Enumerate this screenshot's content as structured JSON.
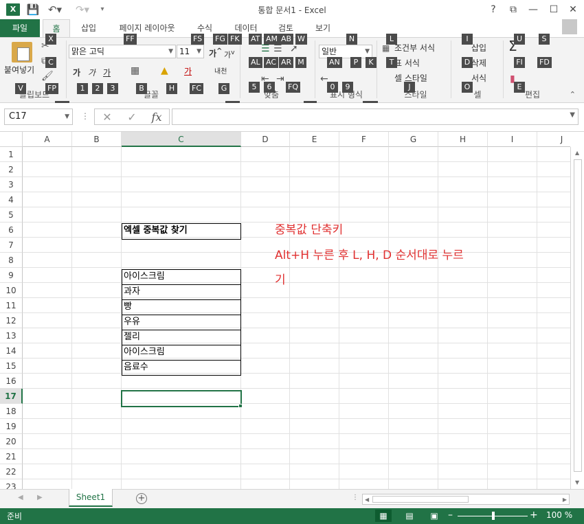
{
  "window": {
    "title": "통합 문서1 - Excel",
    "help": "?",
    "minimize": "—",
    "restore": "☐",
    "close": "✕",
    "ribbon_display": "⧉"
  },
  "tabs": [
    {
      "label": "파일"
    },
    {
      "label": "홈"
    },
    {
      "label": "삽입"
    },
    {
      "label": "페이지 레이아웃"
    },
    {
      "label": "수식"
    },
    {
      "label": "데이터"
    },
    {
      "label": "검토"
    },
    {
      "label": "보기"
    }
  ],
  "ribbon": {
    "paste_label": "붙여넣기",
    "font_name": "맑은 고딕",
    "font_size": "11",
    "bold": "가",
    "italic": "가",
    "underline": "가",
    "number_format": "일반",
    "conditional_format": "조건부 서식",
    "table_format": "표 서식",
    "cell_style": "셀 스타일",
    "insert": "삽입",
    "delete": "삭제",
    "format": "서식",
    "sum": "Σ",
    "groups": {
      "clipboard": "클립보드",
      "font": "글꼴",
      "alignment": "맞춤",
      "number": "표시 형식",
      "styles": "스타일",
      "cells": "셀",
      "editing": "편집"
    },
    "keytips": {
      "paste": "V",
      "cut": "X",
      "copy": "C",
      "format_painter": "FP",
      "clipboard_launcher": "FO",
      "font_name": "FF",
      "font_size": "FS",
      "grow": "FG",
      "shrink": "FK",
      "bold": "1",
      "italic": "2",
      "underline": "3",
      "borders": "B",
      "fill": "H",
      "font_color": "FC",
      "phonetic": "G",
      "font_launcher": "FN",
      "align_top": "AT",
      "align_middle": "AM",
      "align_bottom": "AB",
      "orientation": "FQ",
      "wrap": "W",
      "align_left": "AL",
      "align_center": "AC",
      "align_right": "AR",
      "merge": "M",
      "indent_dec": "5",
      "indent_inc": "6",
      "number_format": "N",
      "accounting": "AN",
      "percent": "P",
      "comma": "K",
      "dec_inc": "0",
      "dec_dec": "9",
      "number_launcher": "FM",
      "align_launcher": "FA",
      "conditional": "L",
      "table": "T",
      "cell_style": "J",
      "insert": "I",
      "delete": "D",
      "format": "O",
      "sum": "U",
      "fill_down": "FI",
      "clear": "E",
      "sort": "S",
      "find": "FD"
    }
  },
  "formula_bar": {
    "name_box": "C17",
    "fx": "fx",
    "cancel": "✕",
    "enter": "✓",
    "formula": ""
  },
  "sheet": {
    "columns": [
      "A",
      "B",
      "C",
      "D",
      "E",
      "F",
      "G",
      "H",
      "I",
      "J"
    ],
    "rows": [
      "1",
      "2",
      "3",
      "4",
      "5",
      "6",
      "7",
      "8",
      "9",
      "10",
      "11",
      "12",
      "13",
      "14",
      "15",
      "16",
      "17",
      "18",
      "19",
      "20",
      "21",
      "22",
      "23"
    ],
    "cells": {
      "C6": "엑셀 중복값 찾기",
      "C9": "아이스크림",
      "C10": "과자",
      "C11": "빵",
      "C12": "우유",
      "C13": "젤리",
      "C14": "아이스크림",
      "C15": "음료수"
    },
    "note_line1": "중복값 단축키",
    "note_line2": "Alt+H 누른 후 L, H, D 순서대로 누르",
    "note_line3": "기",
    "note_color": "#e03030",
    "active_cell": "C17"
  },
  "sheet_tabs": {
    "tab": "Sheet1",
    "add": "+"
  },
  "status": {
    "ready": "준비",
    "zoom": "100 %",
    "accent": "#217346"
  }
}
